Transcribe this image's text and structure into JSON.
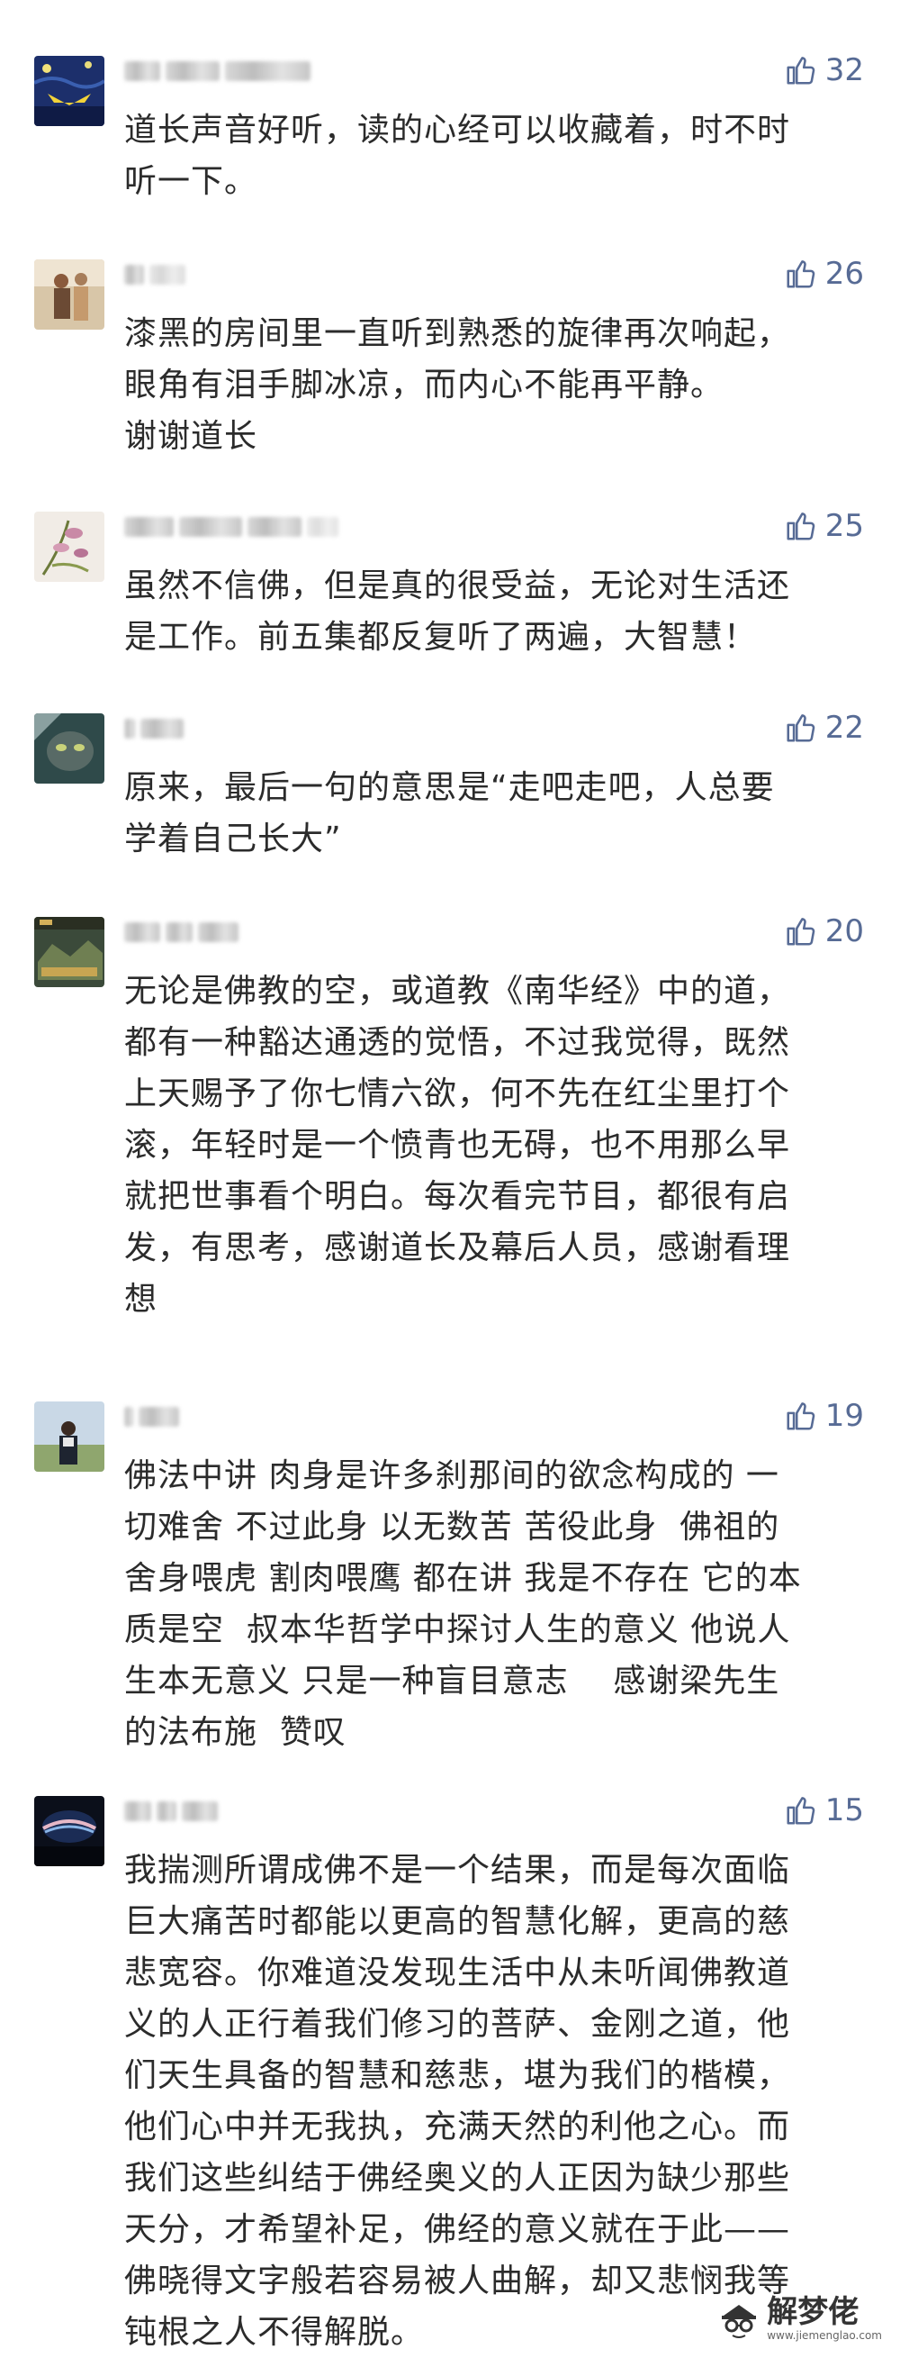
{
  "comments": [
    {
      "likes": "32",
      "text": "道长声音好听，读的心经可以收藏着，时不时\n听一下。"
    },
    {
      "likes": "26",
      "text": "漆黑的房间里一直听到熟悉的旋律再次响起，\n眼角有泪手脚冰凉，而内心不能再平静。\n谢谢道长"
    },
    {
      "likes": "25",
      "text": "虽然不信佛，但是真的很受益，无论对生活还\n是工作。前五集都反复听了两遍，大智慧！"
    },
    {
      "likes": "22",
      "text": "原来，最后一句的意思是“走吧走吧，人总要\n学着自己长大”"
    },
    {
      "likes": "20",
      "text": "无论是佛教的空，或道教《南华经》中的道，\n都有一种豁达通透的觉悟，不过我觉得，既然\n上天赐予了你七情六欲，何不先在红尘里打个\n滚，年轻时是一个愤青也无碍，也不用那么早\n就把世事看个明白。每次看完节目，都很有启\n发，有思考，感谢道长及幕后人员，感谢看理\n想"
    },
    {
      "likes": "19",
      "text": "佛法中讲 肉身是许多刹那间的欲念构成的 一\n切难舍 不过此身 以无数苦 苦役此身  佛祖的\n舍身喂虎 割肉喂鹰 都在讲 我是不存在 它的本\n质是空  叔本华哲学中探讨人生的意义 他说人\n生本无意义 只是一种盲目意志    感谢梁先生\n的法布施  赞叹"
    },
    {
      "likes": "15",
      "text": "我揣测所谓成佛不是一个结果，而是每次面临\n巨大痛苦时都能以更高的智慧化解，更高的慈\n悲宽容。你难道没发现生活中从未听闻佛教道\n义的人正行着我们修习的菩萨、金刚之道，他\n们天生具备的智慧和慈悲，堪为我们的楷模，\n他们心中并无我执，充满天然的利他之心。而\n我们这些纠结于佛经奥义的人正因为缺少那些\n天分，才希望补足，佛经的意义就在于此——\n佛晓得文字般若容易被人曲解，却又悲悯我等\n钝根之人不得解脱。"
    }
  ],
  "watermark": {
    "title": "解梦佬",
    "url": "www.jiemenglao.com"
  },
  "colors": {
    "like": "#576b95",
    "text": "#2b2b2b",
    "background": "#ffffff"
  },
  "icons": {
    "like": "thumbs-up-icon",
    "watermark": "hat-glasses-icon"
  }
}
